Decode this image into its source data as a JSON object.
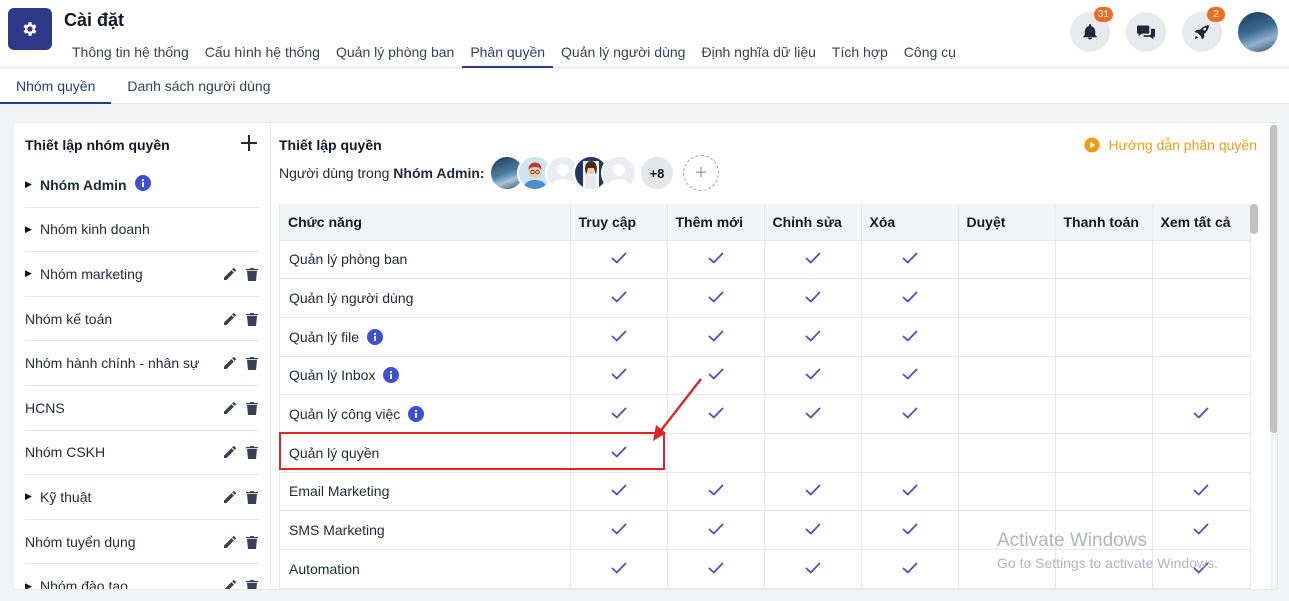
{
  "app": {
    "title": "Cài đặt",
    "icon": "gear-icon"
  },
  "nav": {
    "items": [
      "Thông tin hệ thống",
      "Cấu hình hệ thống",
      "Quản lý phòng ban",
      "Phân quyền",
      "Quản lý người dùng",
      "Định nghĩa dữ liệu",
      "Tích hợp",
      "Công cụ"
    ],
    "active": "Phân quyền"
  },
  "header_actions": {
    "notifications_count": "31",
    "rocket_count": "2",
    "icons": [
      "bell-icon",
      "chat-icon",
      "rocket-icon",
      "avatar"
    ]
  },
  "sub_tabs": [
    "Nhóm quyền",
    "Danh sách người dùng"
  ],
  "left_panel": {
    "title": "Thiết lập nhóm quyền",
    "groups": [
      {
        "name": "Nhóm Admin",
        "expandable": true,
        "bold": true,
        "info": true,
        "actions": false
      },
      {
        "name": "Nhóm kinh doanh",
        "expandable": true,
        "bold": false,
        "info": false,
        "actions": false
      },
      {
        "name": "Nhóm marketing",
        "expandable": true,
        "bold": false,
        "info": false,
        "actions": true
      },
      {
        "name": "Nhóm kế toán",
        "expandable": false,
        "bold": false,
        "info": false,
        "actions": true
      },
      {
        "name": "Nhóm hành chính - nhân sự",
        "expandable": false,
        "bold": false,
        "info": false,
        "actions": true
      },
      {
        "name": "HCNS",
        "expandable": false,
        "bold": false,
        "info": false,
        "actions": true
      },
      {
        "name": "Nhóm CSKH",
        "expandable": false,
        "bold": false,
        "info": false,
        "actions": true
      },
      {
        "name": "Kỹ thuật",
        "expandable": true,
        "bold": false,
        "info": false,
        "actions": true
      },
      {
        "name": "Nhóm tuyển dụng",
        "expandable": false,
        "bold": false,
        "info": false,
        "actions": true
      },
      {
        "name": "Nhóm đào tạo",
        "expandable": true,
        "bold": false,
        "info": false,
        "actions": true
      }
    ]
  },
  "right_panel": {
    "title": "Thiết lập quyền",
    "guide_label": "Hướng dẫn phân quyền",
    "users_prefix": "Người dùng trong",
    "group_name": "Nhóm Admin:",
    "more_users": "+8",
    "add_icon": "+",
    "columns": [
      "Chức năng",
      "Truy cập",
      "Thêm mới",
      "Chỉnh sửa",
      "Xóa",
      "Duyệt",
      "Thanh toán",
      "Xem tất cả"
    ],
    "rows": [
      {
        "name": "Quản lý phòng ban",
        "info": false,
        "perms": [
          true,
          true,
          true,
          true,
          false,
          false,
          false
        ]
      },
      {
        "name": "Quản lý người dùng",
        "info": false,
        "perms": [
          true,
          true,
          true,
          true,
          false,
          false,
          false
        ]
      },
      {
        "name": "Quản lý file",
        "info": true,
        "perms": [
          true,
          true,
          true,
          true,
          false,
          false,
          false
        ]
      },
      {
        "name": "Quản lý Inbox",
        "info": true,
        "perms": [
          true,
          true,
          true,
          true,
          false,
          false,
          false
        ]
      },
      {
        "name": "Quản lý công việc",
        "info": true,
        "perms": [
          true,
          true,
          true,
          true,
          false,
          false,
          true
        ]
      },
      {
        "name": "Quản lý quyền",
        "info": false,
        "perms": [
          true,
          false,
          false,
          false,
          false,
          false,
          false
        ]
      },
      {
        "name": "Email Marketing",
        "info": false,
        "perms": [
          true,
          true,
          true,
          true,
          false,
          false,
          true
        ]
      },
      {
        "name": "SMS Marketing",
        "info": false,
        "perms": [
          true,
          true,
          true,
          true,
          false,
          false,
          true
        ]
      },
      {
        "name": "Automation",
        "info": false,
        "perms": [
          true,
          true,
          true,
          true,
          false,
          false,
          true
        ]
      }
    ]
  },
  "colors": {
    "primary": "#2e3a87",
    "check": "#4a4fc4",
    "info": "#3b4fd8",
    "badge": "#f26b22",
    "guide": "#f39c12",
    "highlight": "#e02424"
  },
  "watermark": {
    "line1": "Activate Windows",
    "line2": "Go to Settings to activate Windows."
  }
}
